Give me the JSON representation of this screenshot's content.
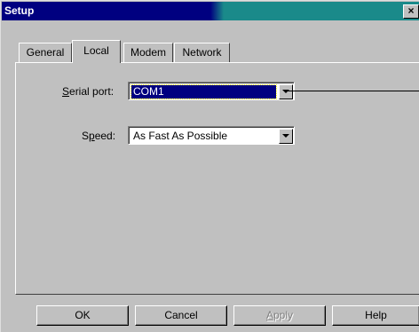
{
  "window": {
    "title": "Setup",
    "close_glyph": "×"
  },
  "tabs": [
    {
      "label": "General",
      "selected": false
    },
    {
      "label": "Local",
      "selected": true
    },
    {
      "label": "Modem",
      "selected": false
    },
    {
      "label": "Network",
      "selected": false
    }
  ],
  "serial_port": {
    "label_mnemonic": "S",
    "label_rest": "erial port:",
    "value": "COM1",
    "focused": true
  },
  "speed": {
    "label_pre": "S",
    "label_mnemonic": "p",
    "label_rest": "eed:",
    "value": "As Fast As Possible"
  },
  "buttons": {
    "ok": "OK",
    "cancel": "Cancel",
    "apply_mnemonic": "A",
    "apply_rest": "pply",
    "apply_enabled": false,
    "help": "Help"
  },
  "colors": {
    "titlebar_active": "#000080",
    "titlebar_accent": "#1a8a8a",
    "face": "#c0c0c0"
  },
  "icons": {
    "dropdown": "dropdown-arrow-icon",
    "close": "close-icon"
  }
}
